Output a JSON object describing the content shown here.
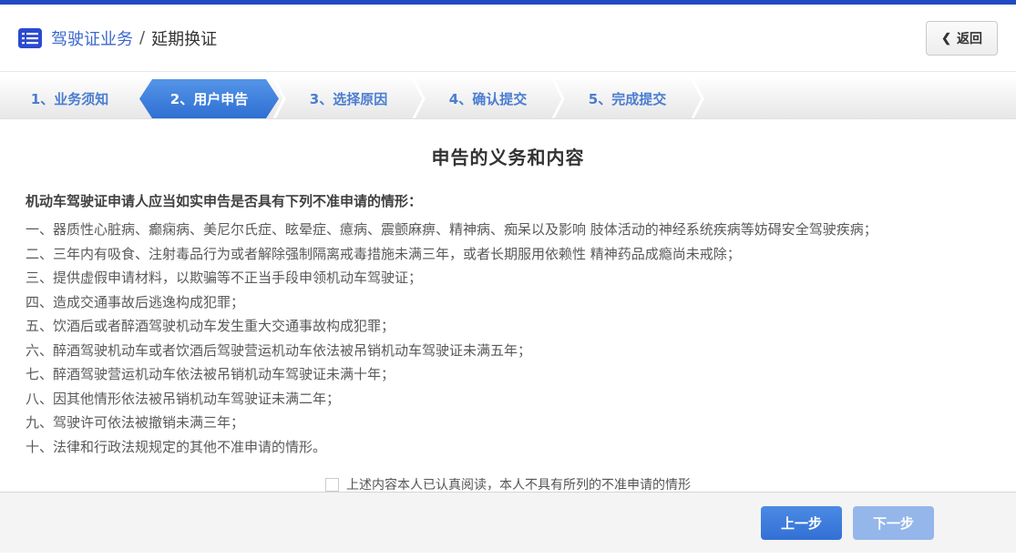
{
  "header": {
    "title_primary": "驾驶证业务",
    "title_separator": "/",
    "title_secondary": "延期换证",
    "back_icon": "❮",
    "back_label": "返回"
  },
  "steps": [
    {
      "label": "1、业务须知",
      "active": false
    },
    {
      "label": "2、用户申告",
      "active": true
    },
    {
      "label": "3、选择原因",
      "active": false
    },
    {
      "label": "4、确认提交",
      "active": false
    },
    {
      "label": "5、完成提交",
      "active": false
    }
  ],
  "content": {
    "title": "申告的义务和内容",
    "intro": "机动车驾驶证申请人应当如实申告是否具有下列不准申请的情形：",
    "items": [
      "一、器质性心脏病、癫痫病、美尼尔氏症、眩晕症、癔病、震颤麻痹、精神病、痴呆以及影响 肢体活动的神经系统疾病等妨碍安全驾驶疾病；",
      "二、三年内有吸食、注射毒品行为或者解除强制隔离戒毒措施未满三年，或者长期服用依赖性 精神药品成瘾尚未戒除；",
      "三、提供虚假申请材料，以欺骗等不正当手段申领机动车驾驶证；",
      "四、造成交通事故后逃逸构成犯罪；",
      "五、饮酒后或者醉酒驾驶机动车发生重大交通事故构成犯罪；",
      "六、醉酒驾驶机动车或者饮酒后驾驶营运机动车依法被吊销机动车驾驶证未满五年；",
      "七、醉酒驾驶营运机动车依法被吊销机动车驾驶证未满十年；",
      "八、因其他情形依法被吊销机动车驾驶证未满二年；",
      "九、驾驶许可依法被撤销未满三年；",
      "十、法律和行政法规规定的其他不准申请的情形。"
    ],
    "confirm_label": "上述内容本人已认真阅读，本人不具有所列的不准申请的情形",
    "checkbox_checked": false
  },
  "footer": {
    "prev_label": "上一步",
    "next_label": "下一步"
  },
  "colors": {
    "topbar": "#2149c4",
    "accent_blue": "#2e6fd3",
    "step_text_blue": "#4a7dd0",
    "link_blue": "#3c68cc",
    "disabled_button": "#94b6ea",
    "footer_bg": "#f4f4f4"
  }
}
